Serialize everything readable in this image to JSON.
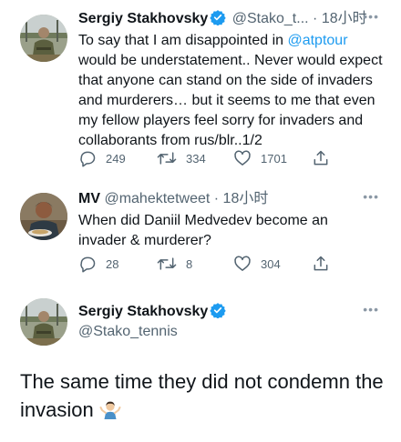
{
  "tweets": [
    {
      "name": "Sergiy Stakhovsky",
      "handle": "@Stako_t...",
      "time": "· 18小时",
      "text_before": "To say that I am disappointed in ",
      "mention": "@atptour",
      "text_after": " would be understatement.. Never would expect that anyone can stand on the side of invaders and murderers… but it seems to me that even my fellow players feel sorry for invaders and collaborants from rus/blr..1/2",
      "replies": "249",
      "retweets": "334",
      "likes": "1701"
    },
    {
      "name": "MV",
      "handle": "@mahektetweet",
      "time": "· 18小时",
      "text": "When did Daniil Medvedev become an invader & murderer?",
      "replies": "28",
      "retweets": "8",
      "likes": "304"
    }
  ],
  "quoted_profile": {
    "name": "Sergiy Stakhovsky",
    "handle": "@Stako_tennis"
  },
  "caption": "The same time they did not condemn the invasion",
  "icons": {
    "verified": "verified-badge-icon",
    "reply": "reply-icon",
    "retweet": "retweet-icon",
    "like": "heart-icon",
    "share": "share-icon",
    "more": "more-icon",
    "emoji": "person-shrugging-emoji"
  },
  "colors": {
    "text": "#0f1419",
    "secondary": "#536471",
    "link": "#1d9bf0",
    "verified": "#1d9bf0"
  }
}
